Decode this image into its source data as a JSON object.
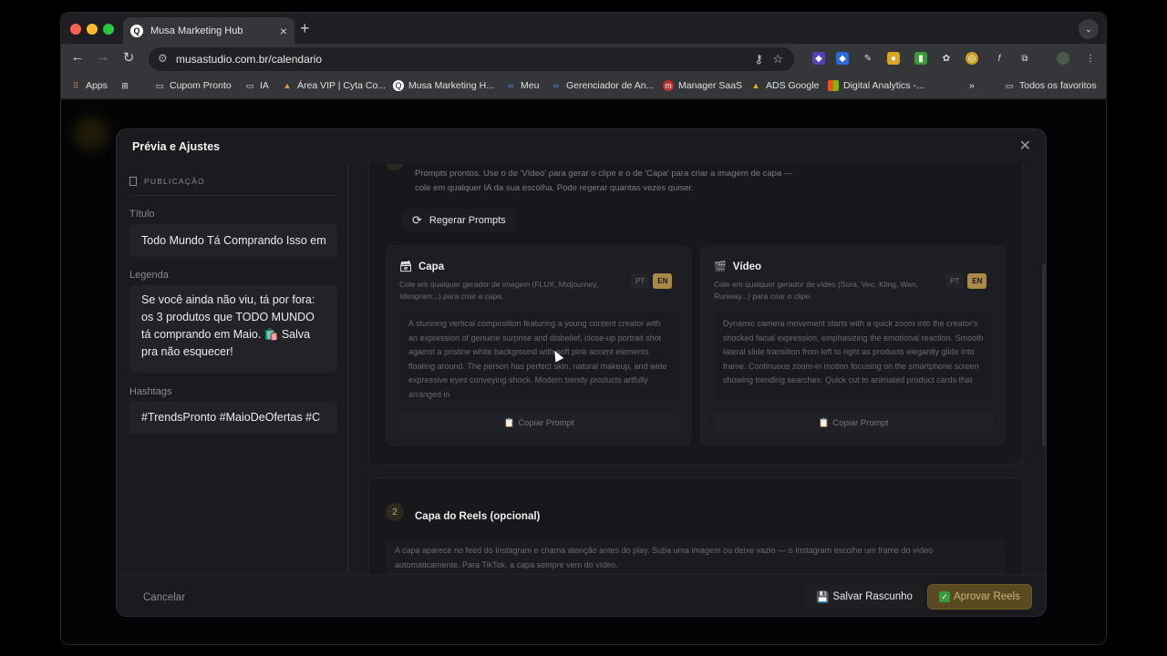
{
  "browser": {
    "tab_title": "Musa Marketing Hub",
    "tab_favicon": "Q",
    "url": "musastudio.com.br/calendario",
    "new_tab": "+",
    "bookmarks": [
      {
        "label": "Apps",
        "icon": "apps-grid-icon"
      },
      {
        "label": "",
        "icon": "tab-groups-icon"
      },
      {
        "label": "Cupom Pronto",
        "icon": "folder-icon"
      },
      {
        "label": "IA",
        "icon": "folder-icon"
      },
      {
        "label": "Área VIP | Cyta Co...",
        "icon": "site-icon"
      },
      {
        "label": "Musa Marketing H...",
        "icon": "site-icon"
      },
      {
        "label": "Meu",
        "icon": "meta-icon"
      },
      {
        "label": "Gerenciador de An...",
        "icon": "meta-icon"
      },
      {
        "label": "Manager SaaS",
        "icon": "site-icon"
      },
      {
        "label": "ADS Google",
        "icon": "google-ads-icon"
      },
      {
        "label": "Digital Analytics -...",
        "icon": "microsoft-icon"
      },
      {
        "label": "Todos os favoritos",
        "icon": "folder-icon"
      }
    ]
  },
  "modal": {
    "title": "Prévia e Ajustes",
    "left": {
      "section_label": "PUBLICAÇÃO",
      "title_label": "Título",
      "title_value": "Todo Mundo Tá Comprando Isso em",
      "caption_label": "Legenda",
      "caption_value": "Se você ainda não viu, tá por fora: os 3 produtos que TODO MUNDO tá comprando em Maio. 🛍️ Salva pra não esquecer!",
      "hashtags_label": "Hashtags",
      "hashtags_value": "#TrendsPronto #MaioDeOfertas #C"
    },
    "section1": {
      "description": "Prompts prontos. Use o de 'Vídeo' para gerar o clipe e o de 'Capa' para criar a imagem de capa — cole em qualquer IA da sua escolha. Pode regerar quantas vezes quiser.",
      "regen_label": "Regerar Prompts",
      "cards": [
        {
          "title": "Capa",
          "subtitle": "Cole em qualquer gerador de imagem (FLUX, Midjourney, Ideogram...) para criar a capa.",
          "lang_pt": "PT",
          "lang_en": "EN",
          "prompt": "A stunning vertical composition featuring a young content creator with an expression of genuine surprise and disbelief, close-up portrait shot against a pristine white background with soft pink accent elements floating around. The person has perfect skin, natural makeup, and wide expressive eyes conveying shock. Modern trendy products artfully arranged in",
          "copy_label": "Copiar Prompt"
        },
        {
          "title": "Vídeo",
          "subtitle": "Cole em qualquer gerador de vídeo (Sora, Veo, Kling, Wan, Runway...) para criar o clipe.",
          "lang_pt": "PT",
          "lang_en": "EN",
          "prompt": "Dynamic camera movement starts with a quick zoom into the creator's shocked facial expression, emphasizing the emotional reaction. Smooth lateral slide transition from left to right as products elegantly glide into frame. Continuous zoom-in motion focusing on the smartphone screen showing trending searches. Quick cut to animated product cards that",
          "copy_label": "Copiar Prompt"
        }
      ]
    },
    "section2": {
      "number": "2",
      "title": "Capa do Reels (opcional)",
      "description": "A capa aparece no feed do Instagram e chama atenção antes do play. Suba uma imagem ou deixe vazio — o Instagram escolhe um frame do vídeo automaticamente. Para TikTok, a capa sempre vem do vídeo."
    },
    "footer": {
      "cancel": "Cancelar",
      "save_draft": "Salvar Rascunho",
      "approve": "Aprovar Reels"
    }
  },
  "colors": {
    "accent_gold": "#a88a45",
    "approve_bg": "#5a4a22",
    "modal_bg": "#1a1a1f"
  }
}
